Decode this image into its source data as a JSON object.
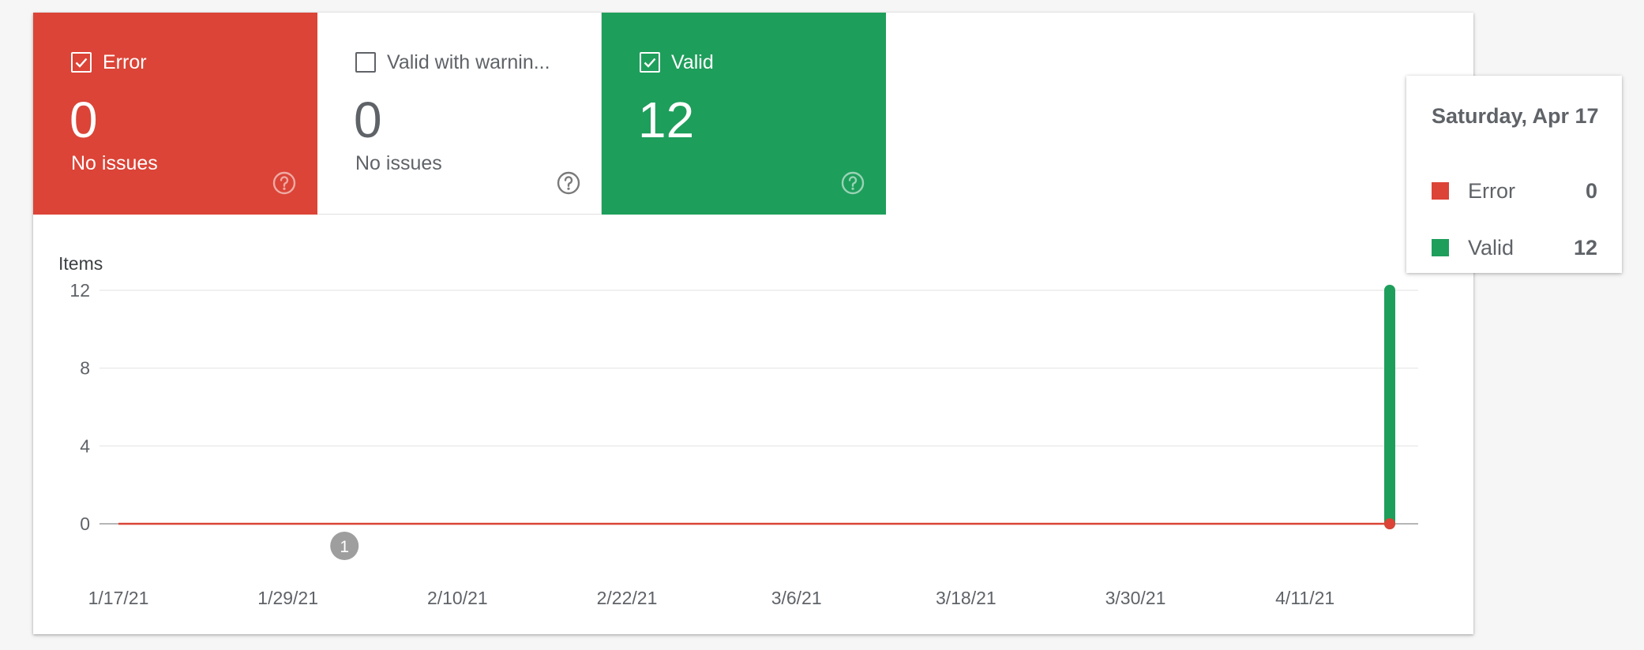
{
  "colors": {
    "error": "#db4437",
    "valid": "#1e9e5b",
    "warning_text": "#5f6368",
    "grid": "#e6e6e6",
    "axis_text": "#5f6368",
    "annotation": "#9e9e9e"
  },
  "tiles": [
    {
      "key": "error",
      "label": "Error",
      "count": "0",
      "subtitle": "No issues",
      "checked": true,
      "icon": "checkbox-checked-icon",
      "help_icon": "help-icon"
    },
    {
      "key": "warning",
      "label": "Valid with warnin...",
      "count": "0",
      "subtitle": "No issues",
      "checked": false,
      "icon": "checkbox-empty-icon",
      "help_icon": "help-icon"
    },
    {
      "key": "valid",
      "label": "Valid",
      "count": "12",
      "subtitle": "",
      "checked": true,
      "icon": "checkbox-checked-icon",
      "help_icon": "help-icon"
    }
  ],
  "chart_data": {
    "type": "line",
    "ylabel": "Items",
    "xlabel": "",
    "ylim": [
      0,
      12
    ],
    "yticks": [
      0,
      4,
      8,
      12
    ],
    "xlim": [
      "2021-01-17",
      "2021-04-17"
    ],
    "xtick_labels": [
      "1/17/21",
      "1/29/21",
      "2/10/21",
      "2/22/21",
      "3/6/21",
      "3/18/21",
      "3/30/21",
      "4/11/21"
    ],
    "xtick_dates": [
      "2021-01-17",
      "2021-01-29",
      "2021-02-10",
      "2021-02-22",
      "2021-03-06",
      "2021-03-18",
      "2021-03-30",
      "2021-04-11"
    ],
    "grid": true,
    "series": [
      {
        "name": "Error",
        "color": "#db4437",
        "x": [
          "2021-01-17",
          "2021-04-17"
        ],
        "values": [
          0,
          0
        ]
      },
      {
        "name": "Valid",
        "color": "#1e9e5b",
        "x": [
          "2021-04-16",
          "2021-04-17"
        ],
        "values": [
          0,
          12
        ]
      }
    ],
    "annotations": [
      {
        "label": "1",
        "date": "2021-02-02"
      }
    ]
  },
  "tooltip": {
    "date": "Saturday, Apr 17",
    "rows": [
      {
        "name": "Error",
        "value": "0",
        "color": "#db4437"
      },
      {
        "name": "Valid",
        "value": "12",
        "color": "#1e9e5b"
      }
    ]
  }
}
